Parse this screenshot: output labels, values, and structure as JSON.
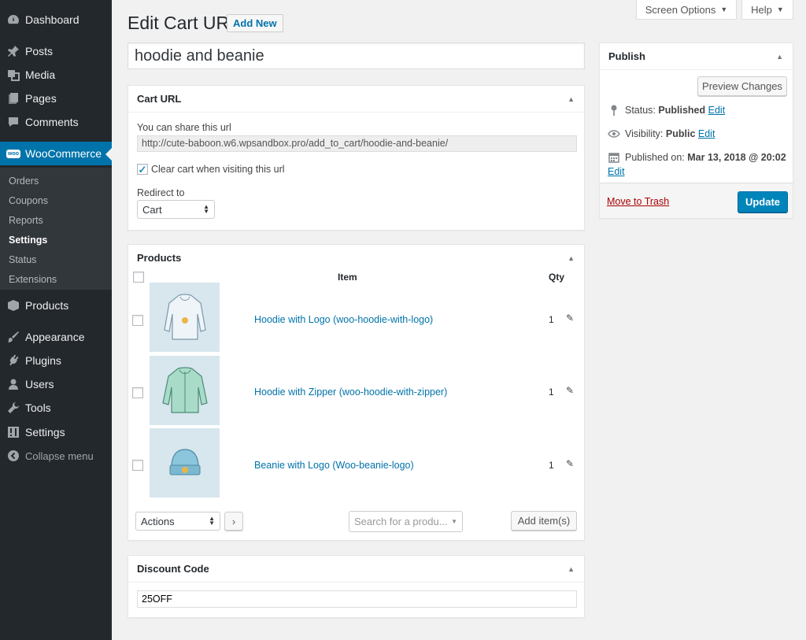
{
  "sidebar": {
    "items": [
      {
        "label": "Dashboard",
        "icon": "dashboard-icon"
      },
      {
        "label": "Posts",
        "icon": "pin-icon"
      },
      {
        "label": "Media",
        "icon": "media-icon"
      },
      {
        "label": "Pages",
        "icon": "pages-icon"
      },
      {
        "label": "Comments",
        "icon": "comment-icon"
      },
      {
        "label": "WooCommerce",
        "icon": "woo-icon"
      },
      {
        "label": "Products",
        "icon": "cube-icon"
      },
      {
        "label": "Appearance",
        "icon": "brush-icon"
      },
      {
        "label": "Plugins",
        "icon": "plug-icon"
      },
      {
        "label": "Users",
        "icon": "user-icon"
      },
      {
        "label": "Tools",
        "icon": "wrench-icon"
      },
      {
        "label": "Settings",
        "icon": "sliders-icon"
      },
      {
        "label": "Collapse menu",
        "icon": "collapse-icon"
      }
    ],
    "woo_badge": "woo",
    "submenu": [
      "Orders",
      "Coupons",
      "Reports",
      "Settings",
      "Status",
      "Extensions"
    ]
  },
  "top": {
    "screen_options": "Screen Options",
    "help": "Help"
  },
  "header": {
    "title": "Edit Cart URL",
    "add_new": "Add New"
  },
  "post_title": "hoodie and beanie",
  "cart_url_box": {
    "heading": "Cart URL",
    "share_label": "You can share this url",
    "url": "http://cute-baboon.w6.wpsandbox.pro/add_to_cart/hoodie-and-beanie/",
    "clear_cart_label": "Clear cart when visiting this url",
    "clear_cart_checked": true,
    "redirect_label": "Redirect to",
    "redirect_value": "Cart"
  },
  "products_box": {
    "heading": "Products",
    "col_item": "Item",
    "col_qty": "Qty",
    "rows": [
      {
        "name": "Hoodie with Logo (woo-hoodie-with-logo)",
        "qty": "1"
      },
      {
        "name": "Hoodie with Zipper (woo-hoodie-with-zipper)",
        "qty": "1"
      },
      {
        "name": "Beanie with Logo (Woo-beanie-logo)",
        "qty": "1"
      }
    ],
    "actions_value": "Actions",
    "search_placeholder": "Search for a produ...",
    "add_items": "Add item(s)"
  },
  "discount_box": {
    "heading": "Discount Code",
    "code": "25OFF"
  },
  "publish_box": {
    "heading": "Publish",
    "preview": "Preview Changes",
    "status_label": "Status:",
    "status_value": "Published",
    "visibility_label": "Visibility:",
    "visibility_value": "Public",
    "published_label": "Published on:",
    "published_value": "Mar 13, 2018 @ 20:02",
    "edit": "Edit",
    "trash": "Move to Trash",
    "update": "Update"
  },
  "colors": {
    "accent": "#0073aa",
    "sidebar": "#23282d",
    "primary_button": "#0085ba",
    "trash": "#a00"
  }
}
